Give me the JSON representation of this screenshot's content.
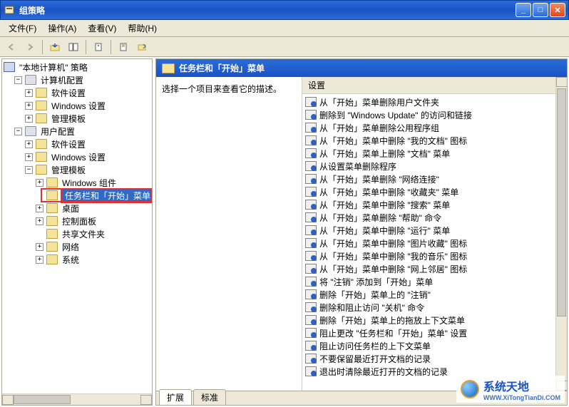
{
  "window": {
    "title": "组策略"
  },
  "menu": {
    "file": "文件(F)",
    "action": "操作(A)",
    "view": "查看(V)",
    "help": "帮助(H)"
  },
  "tree": {
    "root": "\"本地计算机\" 策略",
    "computer_cfg": "计算机配置",
    "software_settings": "软件设置",
    "windows_settings": "Windows 设置",
    "admin_templates": "管理模板",
    "user_cfg": "用户配置",
    "windows_components": "Windows 组件",
    "taskbar_start": "任务栏和「开始」菜单",
    "desktop": "桌面",
    "control_panel": "控制面板",
    "shared_folders": "共享文件夹",
    "network": "网络",
    "system": "系统"
  },
  "right": {
    "header": "任务栏和「开始」菜单",
    "description": "选择一个项目来查看它的描述。",
    "column_header": "设置",
    "items": [
      "从「开始」菜单删除用户文件夹",
      "删除到 \"Windows Update\" 的访问和链接",
      "从「开始」菜单删除公用程序组",
      "从「开始」菜单中删除 \"我的文档\" 图标",
      "从「开始」菜单上删除 \"文档\" 菜单",
      "从设置菜单删除程序",
      "从「开始」菜单删除 \"网络连接\"",
      "从「开始」菜单中删除 \"收藏夹\" 菜单",
      "从「开始」菜单中删除 \"搜索\" 菜单",
      "从「开始」菜单删除 \"帮助\" 命令",
      "从「开始」菜单中删除 \"运行\" 菜单",
      "从「开始」菜单中删除 \"图片收藏\" 图标",
      "从「开始」菜单中删除 \"我的音乐\" 图标",
      "从「开始」菜单中删除 \"网上邻居\" 图标",
      "将 \"注销\" 添加到「开始」菜单",
      "删除「开始」菜单上的 \"注销\"",
      "删除和阻止访问 \"关机\" 命令",
      "删除「开始」菜单上的拖放上下文菜单",
      "阻止更改 \"任务栏和「开始」菜单\" 设置",
      "阻止访问任务栏的上下文菜单",
      "不要保留最近打开文档的记录",
      "退出时清除最近打开的文档的记录"
    ]
  },
  "tabs": {
    "extended": "扩展",
    "standard": "标准"
  },
  "watermark": {
    "text": "系统天地",
    "url": "WWW.XiTongTianDi.COM"
  }
}
